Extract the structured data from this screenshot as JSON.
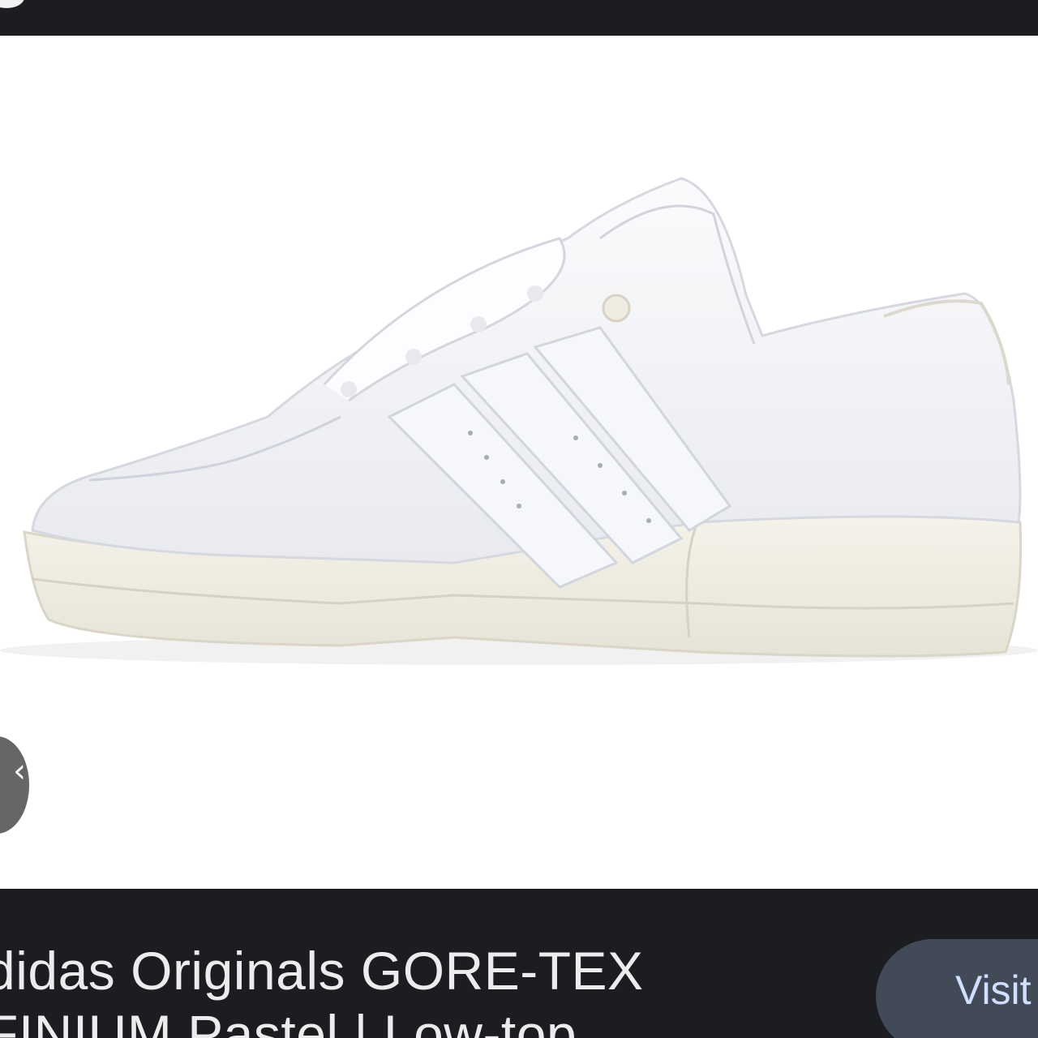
{
  "product": {
    "title": "didas Originals GORE-TEX\nFINIUM Pastel | Low-top"
  },
  "actions": {
    "visit_label": "Visit"
  },
  "icons": {
    "prev": "chevron-left-icon"
  },
  "colors": {
    "bar_bg": "#1c1d21",
    "image_bg": "#ffffff",
    "button_bg": "#424a58",
    "button_text": "#cfe0ff"
  }
}
